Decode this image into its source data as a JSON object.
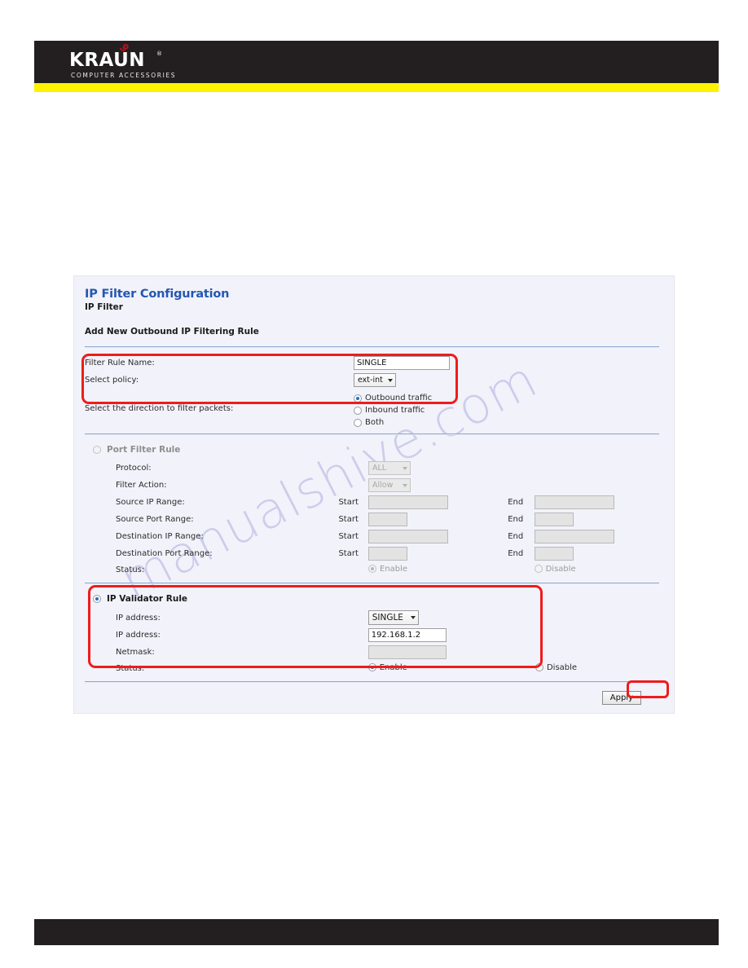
{
  "brand": {
    "name": "KRAUN",
    "registered": "®",
    "tagline": "COMPUTER ACCESSORIES"
  },
  "watermark": {
    "text": "manualshive.com"
  },
  "panel": {
    "title": "IP Filter Configuration",
    "subtitle": "IP Filter",
    "section_heading": "Add New Outbound IP Filtering Rule"
  },
  "general": {
    "filter_rule_name_label": "Filter Rule Name:",
    "filter_rule_name_value": "SINGLE",
    "select_policy_label": "Select policy:",
    "select_policy_value": "ext-int",
    "direction_label": "Select the direction to filter packets:",
    "direction_options": [
      {
        "label": "Outbound traffic",
        "selected": true
      },
      {
        "label": "Inbound traffic",
        "selected": false
      },
      {
        "label": "Both",
        "selected": false
      }
    ]
  },
  "port_filter_rule": {
    "heading": "Port Filter Rule",
    "selected": false,
    "enabled": false,
    "protocol_label": "Protocol:",
    "protocol_value": "ALL",
    "filter_action_label": "Filter Action:",
    "filter_action_value": "Allow",
    "start_label": "Start",
    "end_label": "End",
    "rows": [
      {
        "label": "Source IP Range:",
        "start": "",
        "end": "",
        "size": "long"
      },
      {
        "label": "Source Port Range:",
        "start": "",
        "end": "",
        "size": "short"
      },
      {
        "label": "Destination IP Range:",
        "start": "",
        "end": "",
        "size": "long"
      },
      {
        "label": "Destination Port Range:",
        "start": "",
        "end": "",
        "size": "short"
      }
    ],
    "status_label": "Status:",
    "status_enable_label": "Enable",
    "status_disable_label": "Disable",
    "status_enable_selected": true,
    "status_disable_selected": false
  },
  "ip_validator_rule": {
    "heading": "IP Validator Rule",
    "selected": true,
    "ip_type_label": "IP address:",
    "ip_type_value": "SINGLE",
    "ip_address_label": "IP address:",
    "ip_address_value": "192.168.1.2",
    "netmask_label": "Netmask:",
    "netmask_value": "",
    "status_label": "Status:",
    "status_enable_label": "Enable",
    "status_disable_label": "Disable",
    "status_enable_selected": true,
    "status_disable_selected": false
  },
  "actions": {
    "apply_label": "Apply"
  },
  "colors": {
    "brand_bar": "#231f20",
    "brand_accent": "#fff200",
    "title_blue": "#2358b0",
    "annotation_red": "#ee1c1c",
    "watermark": "#aeb0e0"
  }
}
